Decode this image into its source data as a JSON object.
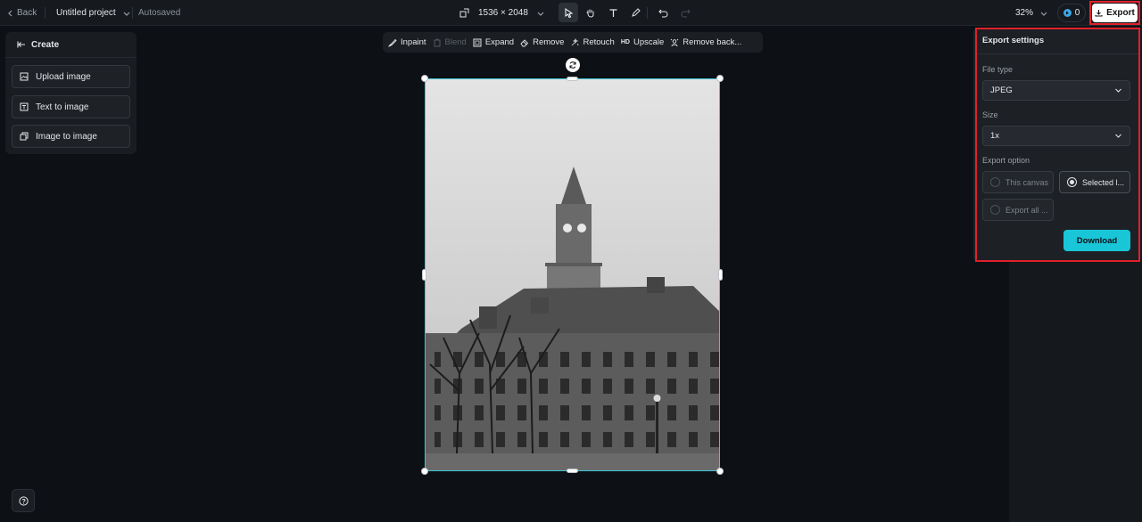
{
  "header": {
    "back_label": "Back",
    "project_title": "Untitled project",
    "autosaved": "Autosaved",
    "dimensions": "1536 × 2048",
    "zoom": "32%",
    "credits": "0",
    "export_label": "Export"
  },
  "create_panel": {
    "title": "Create",
    "items": [
      {
        "label": "Upload image",
        "icon": "upload-image-icon"
      },
      {
        "label": "Text to image",
        "icon": "text-to-image-icon"
      },
      {
        "label": "Image to image",
        "icon": "image-to-image-icon"
      }
    ]
  },
  "edit_toolbar": {
    "items": [
      {
        "label": "Inpaint",
        "icon": "inpaint-brush-icon",
        "enabled": true
      },
      {
        "label": "Blend",
        "icon": "blend-icon",
        "enabled": false
      },
      {
        "label": "Expand",
        "icon": "expand-icon",
        "enabled": true
      },
      {
        "label": "Remove",
        "icon": "eraser-icon",
        "enabled": true
      },
      {
        "label": "Retouch",
        "icon": "retouch-icon",
        "enabled": true
      },
      {
        "label": "Upscale",
        "icon": "hd-icon",
        "icon_text": "HD",
        "enabled": true
      },
      {
        "label": "Remove back...",
        "icon": "remove-background-icon",
        "enabled": true
      }
    ]
  },
  "export_panel": {
    "title": "Export settings",
    "file_type_label": "File type",
    "file_type_value": "JPEG",
    "size_label": "Size",
    "size_value": "1x",
    "export_option_label": "Export option",
    "options": [
      {
        "label": "This canvas",
        "selected": false
      },
      {
        "label": "Selected l...",
        "selected": true
      },
      {
        "label": "Export all ...",
        "selected": false
      }
    ],
    "download_label": "Download"
  },
  "colors": {
    "accent": "#19c6d8",
    "highlight": "#e0202a",
    "selection": "#3ec6d6"
  }
}
